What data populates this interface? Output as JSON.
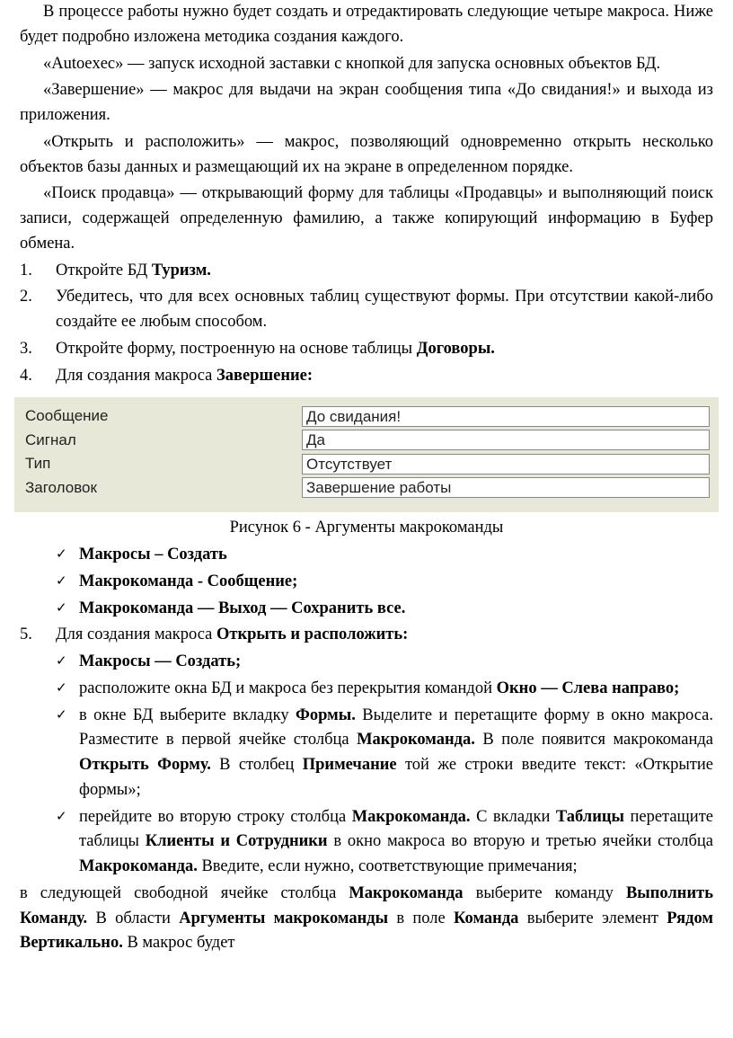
{
  "paragraphs": {
    "p1": "В процессе работы нужно будет создать и отредактировать следующие четыре макроса. Ниже будет подробно изложена методика создания каждого.",
    "p2": "«Autoexec» — запуск исходной заставки с кнопкой для запуска основных объектов БД.",
    "p3": "«Завершение» — макрос для выдачи на экран сообщения типа «До свидания!» и выхода из приложения.",
    "p4": "«Открыть и расположить» — макрос, позволяющий одновременно открыть несколько объектов базы данных и размещающий их на экране в определенном порядке.",
    "p5": "«Поиск продавца» — открывающий форму для таблицы «Продавцы» и выполняющий поиск записи, содержащей определенную фамилию, а также копирующий информацию в Буфер обмена."
  },
  "list": {
    "n1": "1.",
    "i1a": "Откройте БД ",
    "i1b": "Туризм.",
    "n2": "2.",
    "i2": "Убедитесь, что для всех основных таблиц существуют формы. При отсутствии какой-либо создайте ее любым способом.",
    "n3": "3.",
    "i3a": "Откройте форму, построенную на основе таблицы ",
    "i3b": "Договоры.",
    "n4": "4.",
    "i4a": "Для создания макроса ",
    "i4b": "Завершение:",
    "n5": "5.",
    "i5a": "Для создания макроса ",
    "i5b": "Открыть и расположить:"
  },
  "figure": {
    "rows": [
      {
        "label": "Сообщение",
        "value": "До свидания!"
      },
      {
        "label": "Сигнал",
        "value": "Да"
      },
      {
        "label": "Тип",
        "value": "Отсутствует"
      },
      {
        "label": "Заголовок",
        "value": "Завершение работы"
      }
    ],
    "caption": "Рисунок 6 - Аргументы макрокоманды"
  },
  "checks_a": {
    "c1": "Макросы – Создать",
    "c2": "Макрокоманда - Сообщение;",
    "c3": "Макрокоманда — Выход — Сохранить все."
  },
  "checks_b": {
    "c1": "Макросы — Создать;",
    "c2a": "расположите окна БД и макроса без перекрытия командой ",
    "c2b": "Окно — Слева направо;",
    "c3a": "в окне БД выберите вкладку ",
    "c3b": "Формы.",
    "c3c": " Выделите и перетащите форму в окно макроса. Разместите в первой ячейке столбца ",
    "c3d": "Макрокоманда.",
    "c3e": " В поле появится макрокоманда ",
    "c3f": "Открыть Форму.",
    "c3g": " В столбец ",
    "c3h": "Примечание",
    "c3i": " той же строки введите текст: «Открытие формы»;",
    "c4a": "перейдите во вторую строку столбца ",
    "c4b": "Макрокоманда.",
    "c4c": " С вкладки ",
    "c4d": "Таблицы",
    "c4e": " перетащите таблицы ",
    "c4f": "Клиенты и Сотрудники",
    "c4g": " в окно макроса во вторую и третью ячейки столбца ",
    "c4h": "Макрокоманда.",
    "c4i": " Введите, если нужно, соответствующие примечания;"
  },
  "final": {
    "t1": "в следующей свободной ячейке столбца ",
    "t2": "Макрокоманда",
    "t3": " выберите команду ",
    "t4": "Выполнить Команду.",
    "t5": " В области ",
    "t6": "Аргументы макрокоманды",
    "t7": " в поле ",
    "t8": "Команда",
    "t9": " выберите элемент ",
    "t10": "Рядом Вертикально.",
    "t11": " В макрос будет"
  },
  "check_glyph": "✓"
}
